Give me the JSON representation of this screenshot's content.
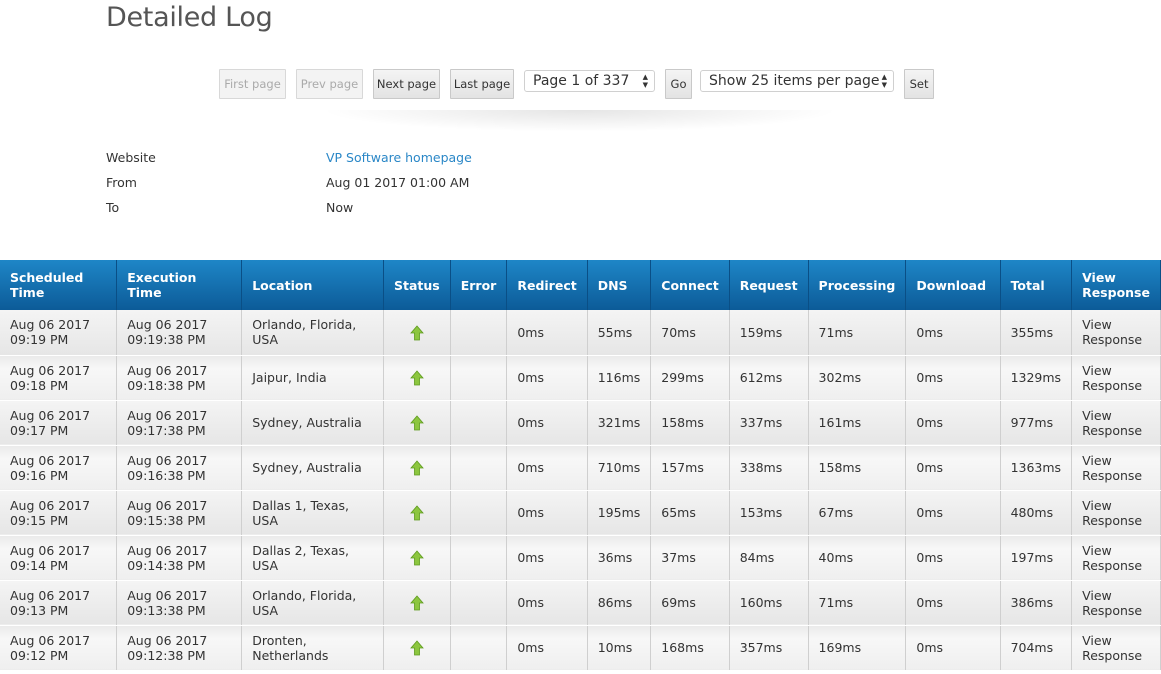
{
  "page_title": "Detailed Log",
  "pager": {
    "first": "First page",
    "prev": "Prev page",
    "next": "Next page",
    "last": "Last page",
    "page_select": "Page 1 of 337",
    "go": "Go",
    "per_page_select": "Show 25 items per page",
    "set": "Set"
  },
  "info": {
    "website_label": "Website",
    "website_value": "VP Software homepage",
    "from_label": "From",
    "from_value": "Aug 01 2017 01:00 AM",
    "to_label": "To",
    "to_value": "Now"
  },
  "table": {
    "headers": {
      "scheduled": "Scheduled Time",
      "execution": "Execution Time",
      "location": "Location",
      "status": "Status",
      "error": "Error",
      "redirect": "Redirect",
      "dns": "DNS",
      "connect": "Connect",
      "request": "Request",
      "processing": "Processing",
      "download": "Download",
      "total": "Total",
      "view": "View Response"
    },
    "status_icon": "up-arrow-icon",
    "status_color": "#8cc63f",
    "header_color": "#1a7bbf",
    "rows": [
      {
        "sched1": "Aug 06 2017",
        "sched2": "09:19 PM",
        "exec1": "Aug 06 2017",
        "exec2": "09:19:38 PM",
        "location": "Orlando, Florida, USA",
        "error": "",
        "redirect": "0ms",
        "dns": "55ms",
        "connect": "70ms",
        "request": "159ms",
        "processing": "71ms",
        "download": "0ms",
        "total": "355ms",
        "view1": "View",
        "view2": "Response"
      },
      {
        "sched1": "Aug 06 2017",
        "sched2": "09:18 PM",
        "exec1": "Aug 06 2017",
        "exec2": "09:18:38 PM",
        "location": "Jaipur, India",
        "error": "",
        "redirect": "0ms",
        "dns": "116ms",
        "connect": "299ms",
        "request": "612ms",
        "processing": "302ms",
        "download": "0ms",
        "total": "1329ms",
        "view1": "View",
        "view2": "Response"
      },
      {
        "sched1": "Aug 06 2017",
        "sched2": "09:17 PM",
        "exec1": "Aug 06 2017",
        "exec2": "09:17:38 PM",
        "location": "Sydney, Australia",
        "error": "",
        "redirect": "0ms",
        "dns": "321ms",
        "connect": "158ms",
        "request": "337ms",
        "processing": "161ms",
        "download": "0ms",
        "total": "977ms",
        "view1": "View",
        "view2": "Response"
      },
      {
        "sched1": "Aug 06 2017",
        "sched2": "09:16 PM",
        "exec1": "Aug 06 2017",
        "exec2": "09:16:38 PM",
        "location": "Sydney, Australia",
        "error": "",
        "redirect": "0ms",
        "dns": "710ms",
        "connect": "157ms",
        "request": "338ms",
        "processing": "158ms",
        "download": "0ms",
        "total": "1363ms",
        "view1": "View",
        "view2": "Response"
      },
      {
        "sched1": "Aug 06 2017",
        "sched2": "09:15 PM",
        "exec1": "Aug 06 2017",
        "exec2": "09:15:38 PM",
        "location": "Dallas 1, Texas, USA",
        "error": "",
        "redirect": "0ms",
        "dns": "195ms",
        "connect": "65ms",
        "request": "153ms",
        "processing": "67ms",
        "download": "0ms",
        "total": "480ms",
        "view1": "View",
        "view2": "Response"
      },
      {
        "sched1": "Aug 06 2017",
        "sched2": "09:14 PM",
        "exec1": "Aug 06 2017",
        "exec2": "09:14:38 PM",
        "location": "Dallas 2, Texas, USA",
        "error": "",
        "redirect": "0ms",
        "dns": "36ms",
        "connect": "37ms",
        "request": "84ms",
        "processing": "40ms",
        "download": "0ms",
        "total": "197ms",
        "view1": "View",
        "view2": "Response"
      },
      {
        "sched1": "Aug 06 2017",
        "sched2": "09:13 PM",
        "exec1": "Aug 06 2017",
        "exec2": "09:13:38 PM",
        "location": "Orlando, Florida, USA",
        "error": "",
        "redirect": "0ms",
        "dns": "86ms",
        "connect": "69ms",
        "request": "160ms",
        "processing": "71ms",
        "download": "0ms",
        "total": "386ms",
        "view1": "View",
        "view2": "Response"
      },
      {
        "sched1": "Aug 06 2017",
        "sched2": "09:12 PM",
        "exec1": "Aug 06 2017",
        "exec2": "09:12:38 PM",
        "location": "Dronten, Netherlands",
        "error": "",
        "redirect": "0ms",
        "dns": "10ms",
        "connect": "168ms",
        "request": "357ms",
        "processing": "169ms",
        "download": "0ms",
        "total": "704ms",
        "view1": "View",
        "view2": "Response"
      }
    ]
  }
}
